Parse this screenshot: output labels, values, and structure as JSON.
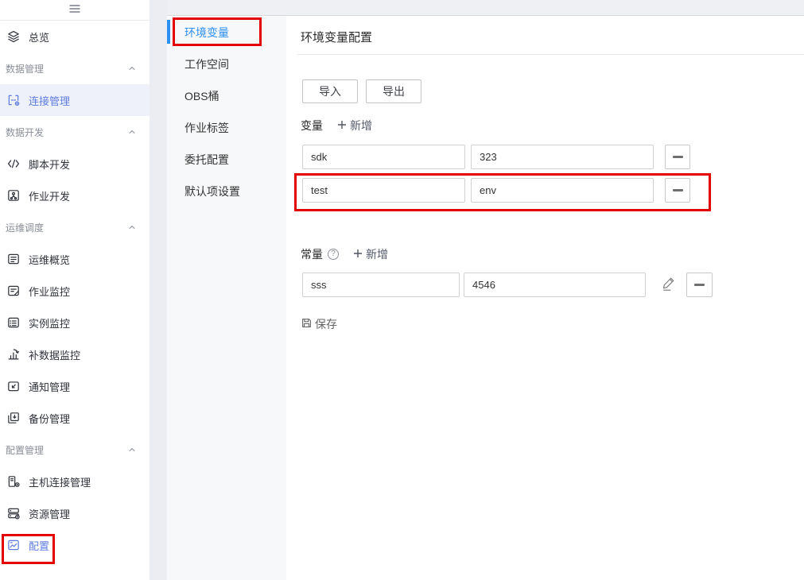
{
  "colors": {
    "sidebar_active_blue": "#5e7ce0",
    "tab_active_blue": "#2e8ff2",
    "annotation_red": "#e50000"
  },
  "sidebar": {
    "items": [
      {
        "type": "item",
        "label": "总览",
        "icon": "layers"
      },
      {
        "type": "group",
        "label": "数据管理"
      },
      {
        "type": "item",
        "label": "连接管理",
        "icon": "connection",
        "active": true,
        "highlighted": true
      },
      {
        "type": "group",
        "label": "数据开发"
      },
      {
        "type": "item",
        "label": "脚本开发",
        "icon": "script"
      },
      {
        "type": "item",
        "label": "作业开发",
        "icon": "job"
      },
      {
        "type": "group",
        "label": "运维调度"
      },
      {
        "type": "item",
        "label": "运维概览",
        "icon": "overview-list"
      },
      {
        "type": "item",
        "label": "作业监控",
        "icon": "job-monitor"
      },
      {
        "type": "item",
        "label": "实例监控",
        "icon": "instance-monitor"
      },
      {
        "type": "item",
        "label": "补数据监控",
        "icon": "data-chart"
      },
      {
        "type": "item",
        "label": "通知管理",
        "icon": "notification"
      },
      {
        "type": "item",
        "label": "备份管理",
        "icon": "backup"
      },
      {
        "type": "group",
        "label": "配置管理"
      },
      {
        "type": "item",
        "label": "主机连接管理",
        "icon": "host"
      },
      {
        "type": "item",
        "label": "资源管理",
        "icon": "resource"
      },
      {
        "type": "item",
        "label": "配置",
        "icon": "config",
        "active": true,
        "annotated": true
      }
    ]
  },
  "tabs": [
    {
      "key": "env-vars",
      "label": "环境变量",
      "active": true,
      "annotated": true
    },
    {
      "key": "workspace",
      "label": "工作空间"
    },
    {
      "key": "obs-bucket",
      "label": "OBS桶"
    },
    {
      "key": "job-tags",
      "label": "作业标签"
    },
    {
      "key": "agency-config",
      "label": "委托配置"
    },
    {
      "key": "default-options",
      "label": "默认项设置"
    }
  ],
  "content": {
    "title": "环境变量配置",
    "import_label": "导入",
    "export_label": "导出",
    "variables": {
      "label": "变量",
      "add_label": "新增",
      "rows": [
        {
          "name": "sdk",
          "value": "323"
        },
        {
          "name": "test",
          "value": "env",
          "annotated": true
        }
      ]
    },
    "constants": {
      "label": "常量",
      "add_label": "新增",
      "rows": [
        {
          "name": "sss",
          "value": "4546",
          "editable": true
        }
      ]
    },
    "save_label": "保存"
  }
}
